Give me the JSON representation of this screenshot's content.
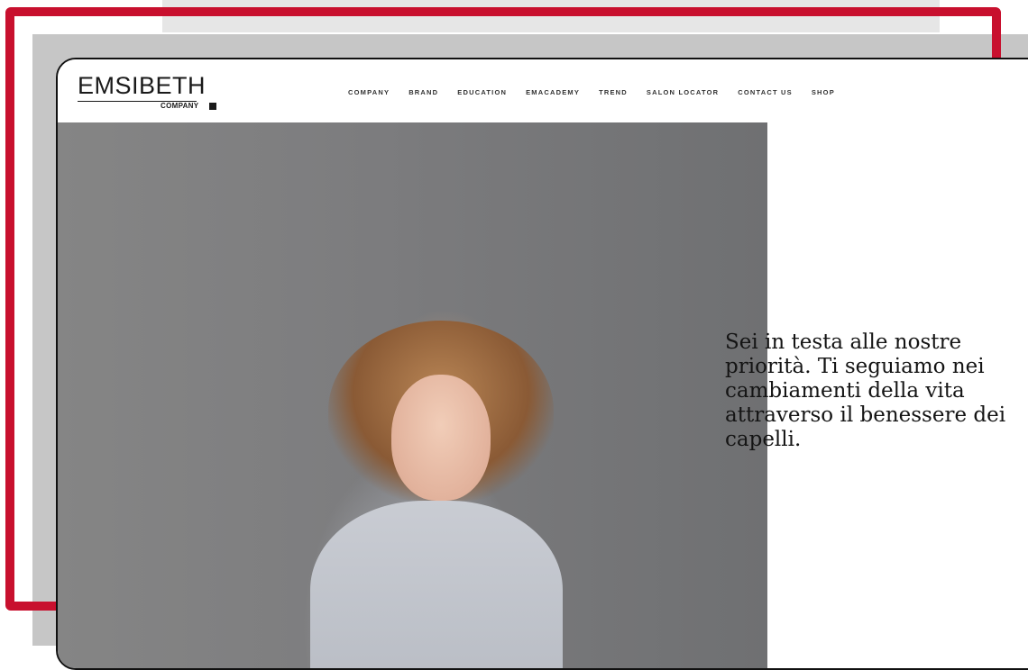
{
  "brand": {
    "logo_main": "EMSIBETH",
    "logo_sub": "COMPANY"
  },
  "nav": {
    "items": [
      "COMPANY",
      "BRAND",
      "EDUCATION",
      "EMACADEMY",
      "TREND",
      "SALON LOCATOR",
      "CONTACT US",
      "SHOP"
    ]
  },
  "hero": {
    "tagline": "Sei in testa alle nostre priorità. Ti seguiamo nei cambiamenti della vita attraverso il benessere dei capelli."
  },
  "colors": {
    "frame_red": "#c8102e",
    "frame_grey": "#c6c6c6",
    "photo_background": "#7c7c7e"
  }
}
